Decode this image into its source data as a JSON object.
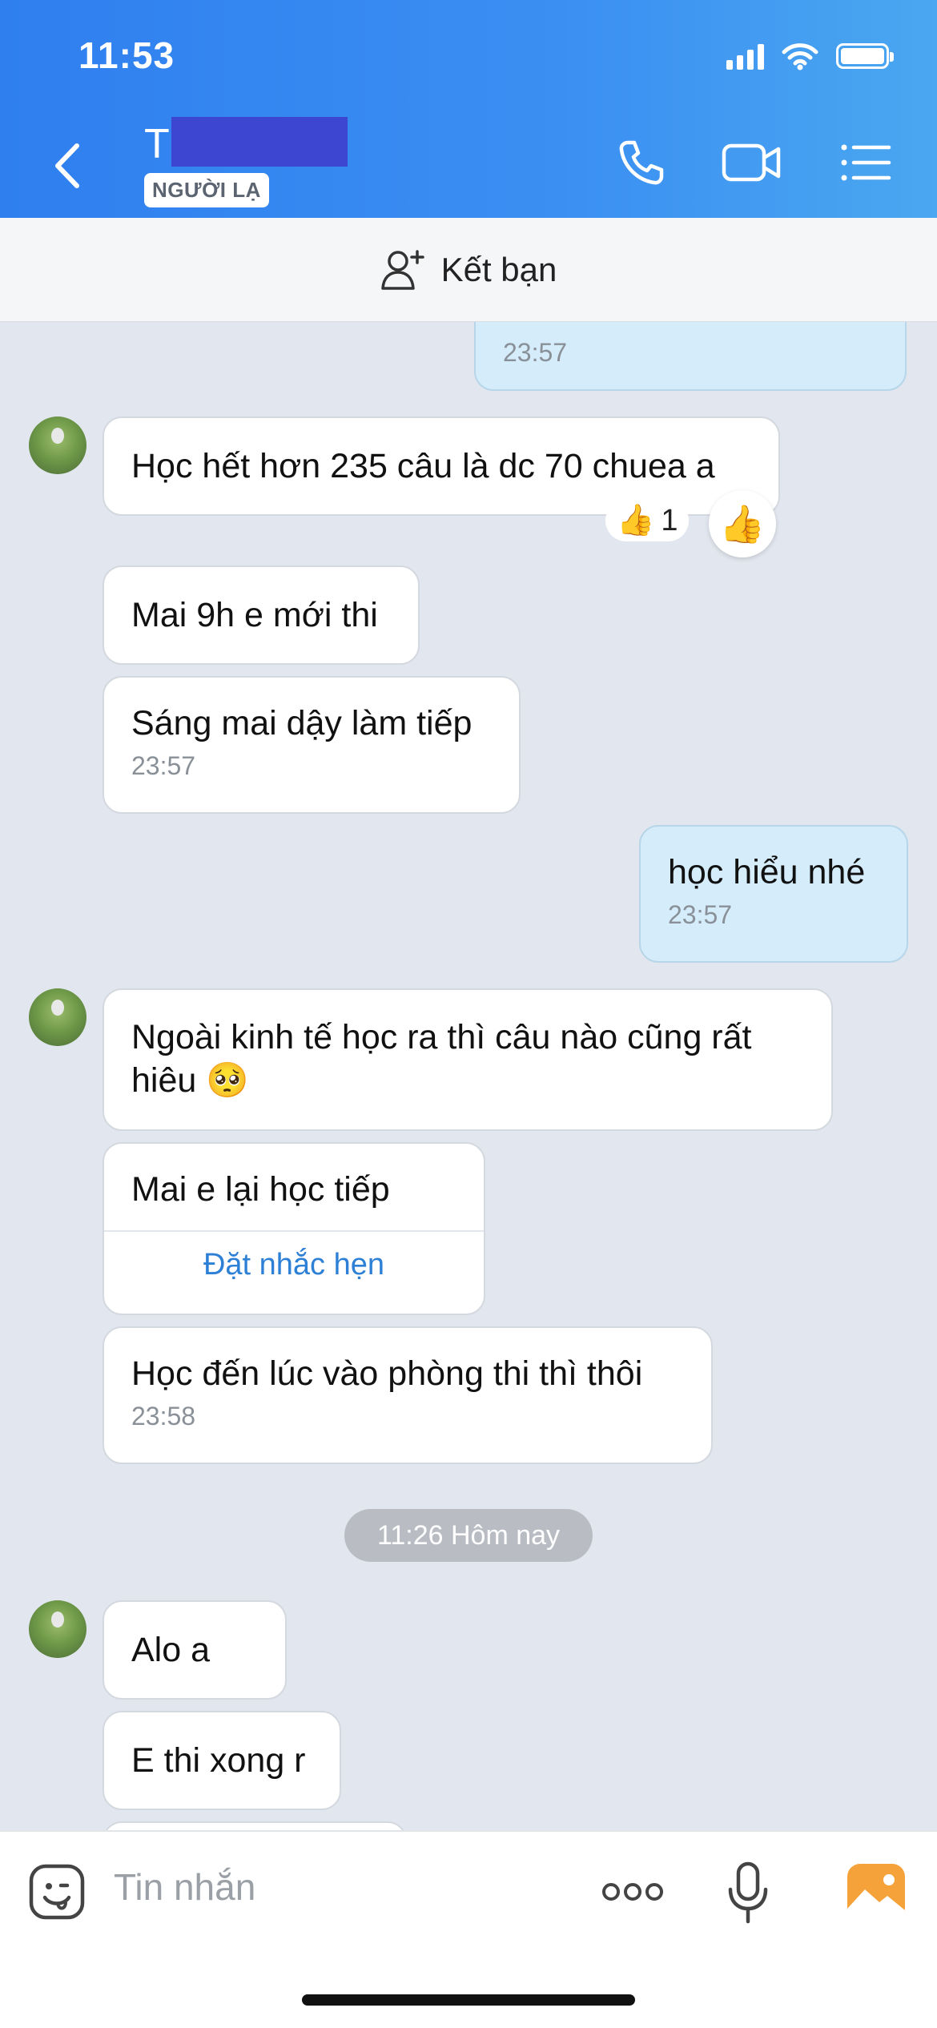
{
  "status_bar": {
    "time": "11:53"
  },
  "header": {
    "contact_name_visible": "T",
    "badge": "NGƯỜI LẠ"
  },
  "friend_bar": {
    "label": "Kết bạn"
  },
  "messages": [
    {
      "side": "me",
      "time": "23:57"
    },
    {
      "side": "them",
      "text": "Học hết hơn 235 câu là dc 70 chuea a",
      "reaction_count": "1"
    },
    {
      "side": "them",
      "text": "Mai 9h e mới thi"
    },
    {
      "side": "them",
      "text": "Sáng mai dậy làm tiếp",
      "time": "23:57"
    },
    {
      "side": "me",
      "text": "học hiểu nhé",
      "time": "23:57"
    },
    {
      "side": "them",
      "text": "Ngoài kinh tế học ra thì câu nào cũng rất hiêu 🥺"
    },
    {
      "side": "them",
      "text": "Mai e lại học tiếp",
      "action": "Đặt nhắc hẹn"
    },
    {
      "side": "them",
      "text": "Học đến lúc vào phòng thi thì thôi",
      "time": "23:58"
    },
    {
      "side": "them",
      "text": "Alo a"
    },
    {
      "side": "them",
      "text": "E thi xong r"
    }
  ],
  "date_separator": "11:26 Hôm nay",
  "input": {
    "placeholder": "Tin nhắn"
  }
}
